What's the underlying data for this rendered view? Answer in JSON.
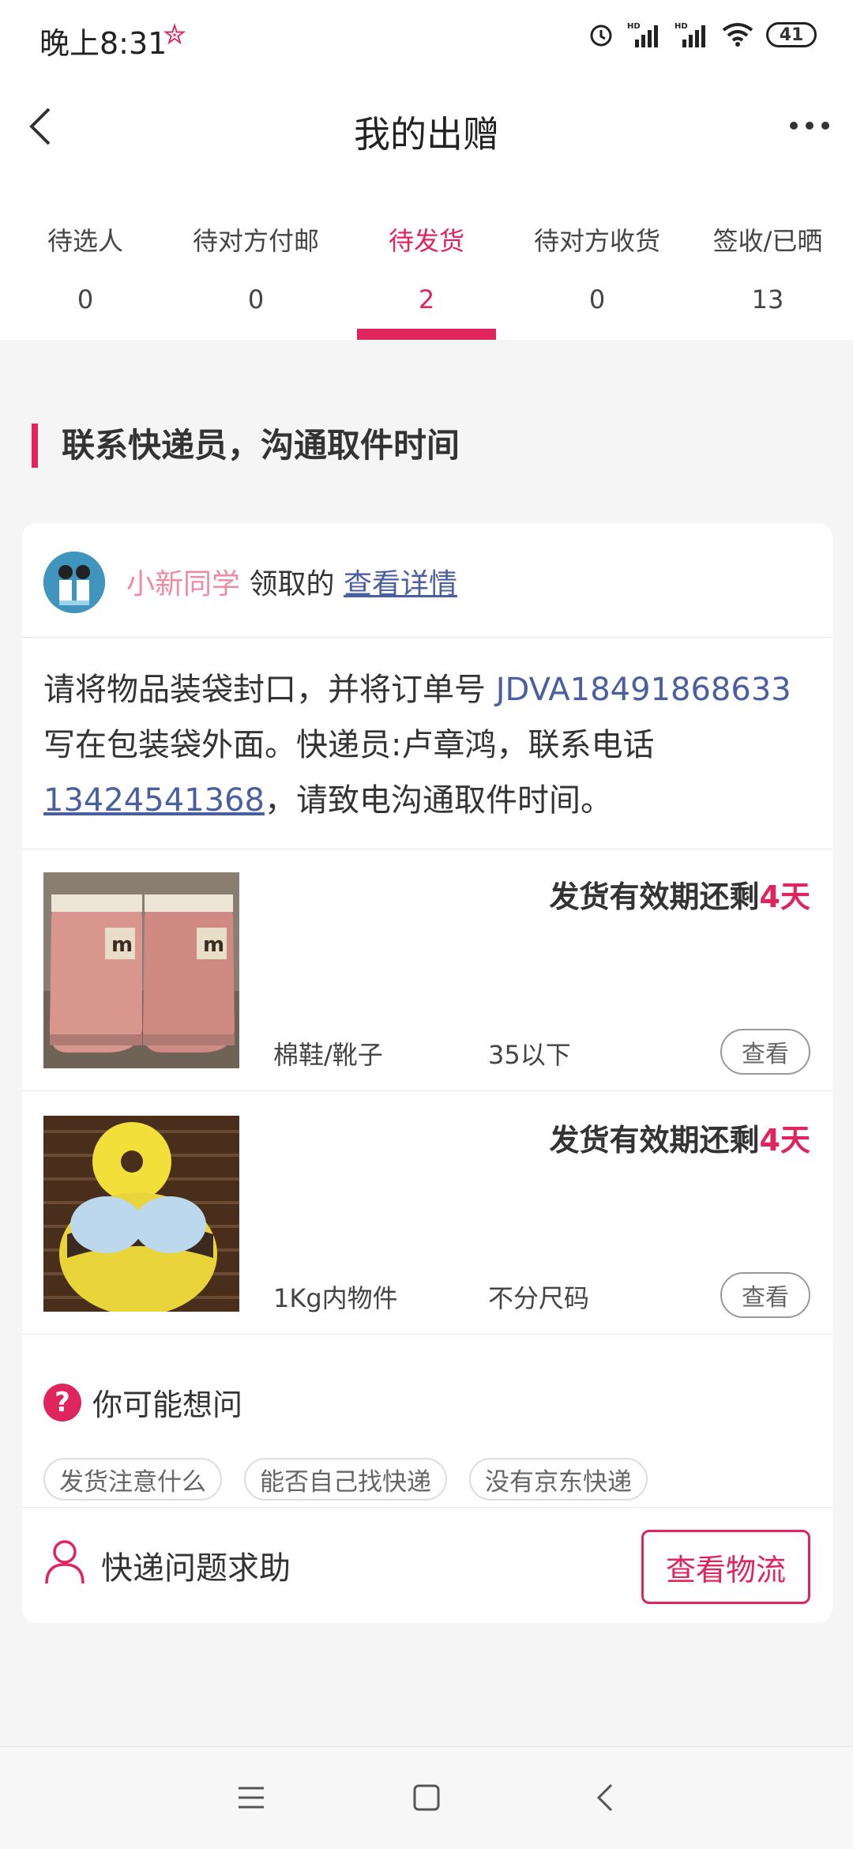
{
  "status_bar": {
    "time": "晚上8:31",
    "battery": "41",
    "net1": "HD",
    "net2": "HD"
  },
  "header": {
    "title": "我的出赠"
  },
  "tabs": [
    {
      "label": "待选人",
      "count": "0"
    },
    {
      "label": "待对方付邮",
      "count": "0"
    },
    {
      "label": "待发货",
      "count": "2",
      "active": true
    },
    {
      "label": "待对方收货",
      "count": "0"
    },
    {
      "label": "签收/已晒",
      "count": "13"
    }
  ],
  "section_title": "联系快递员，沟通取件时间",
  "claim": {
    "user": "小新同学",
    "action": "领取的",
    "detail_link": "查看详情"
  },
  "instruction": {
    "part1": "请将物品装袋封口，并将订单号 ",
    "order_no": "JDVA18491868633",
    "part2": " 写在包装袋外面。快递员:卢章鸿，联系电话",
    "phone": "13424541368",
    "part3": "，请致电沟通取件时间。"
  },
  "items": [
    {
      "deadline_prefix": "发货有效期还剩",
      "days": "4天",
      "category": "棉鞋/靴子",
      "size": "35以下",
      "view": "查看"
    },
    {
      "deadline_prefix": "发货有效期还剩",
      "days": "4天",
      "category": "1Kg内物件",
      "size": "不分尺码",
      "view": "查看"
    }
  ],
  "faq": {
    "title": "你可能想问",
    "chips": [
      "发货注意什么",
      "能否自己找快递",
      "没有京东快递"
    ]
  },
  "help": {
    "label": "快递问题求助",
    "button": "查看物流"
  },
  "colors": {
    "accent": "#e0245e",
    "link": "#4a5fa0",
    "username": "#f08aa0"
  }
}
